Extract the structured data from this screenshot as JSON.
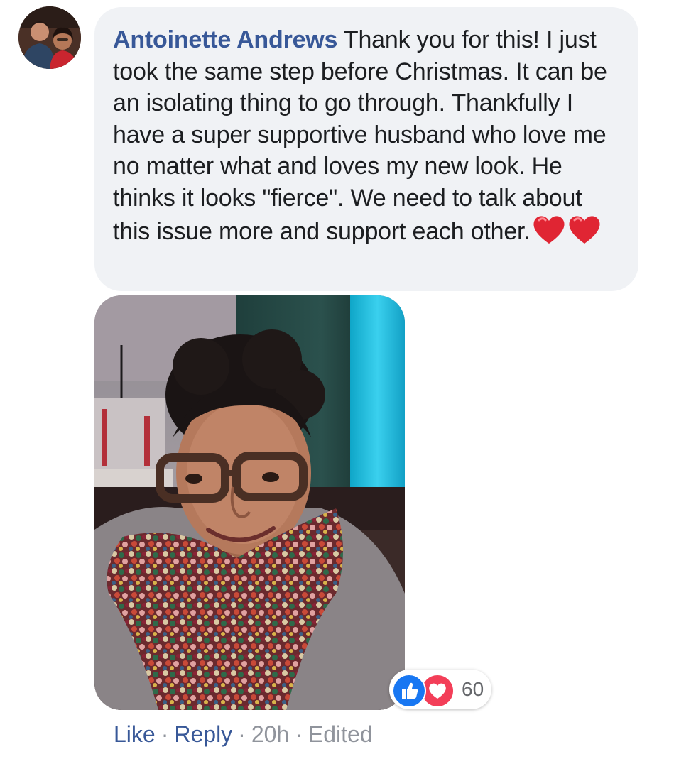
{
  "comment": {
    "author": "Antoinette Andrews",
    "text": "Thank you for this! I just took the same step before Christmas. It can be an isolating thing to go through. Thankfully I have a super supportive husband who love me no matter what and loves my new look. He thinks it looks \"fierce\". We need to talk about this issue more and support each other.",
    "emoji": [
      "red-heart",
      "red-heart"
    ]
  },
  "reactions": {
    "types": [
      "like",
      "love"
    ],
    "count": "60"
  },
  "actions": {
    "like": "Like",
    "reply": "Reply",
    "time": "20h",
    "edited": "Edited",
    "separator": "·"
  },
  "colors": {
    "author": "#385898",
    "bubble": "#f0f2f5",
    "meta": "#90949c",
    "like": "#1877f2",
    "love": "#f33e58"
  }
}
